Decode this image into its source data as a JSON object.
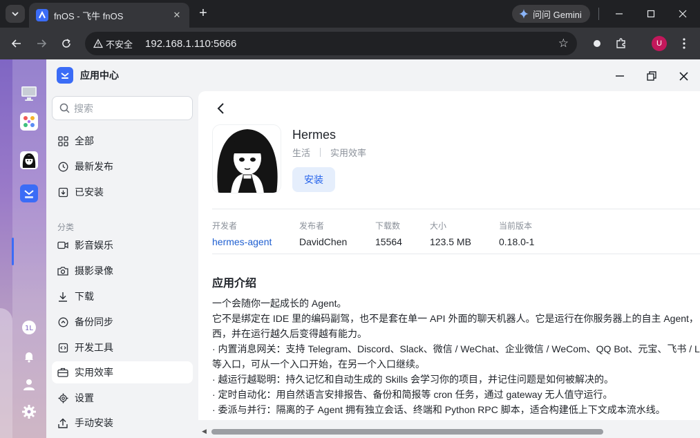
{
  "browser": {
    "tab_title": "fnOS - 飞牛 fnOS",
    "tab_close": "✕",
    "new_tab": "+",
    "gemini_label": "问问 Gemini",
    "insecure_label": "不安全",
    "url": "192.168.1.110:5666",
    "profile_initial": "U"
  },
  "window": {
    "title": "应用中心"
  },
  "sidebar": {
    "search_placeholder": "搜索",
    "items": [
      {
        "label": "全部",
        "icon": "grid-icon"
      },
      {
        "label": "最新发布",
        "icon": "clock-icon"
      },
      {
        "label": "已安装",
        "icon": "install-box-icon"
      }
    ],
    "section_label": "分类",
    "categories": [
      {
        "label": "影音娱乐",
        "icon": "video-icon"
      },
      {
        "label": "摄影录像",
        "icon": "camera-icon"
      },
      {
        "label": "下载",
        "icon": "download-icon"
      },
      {
        "label": "备份同步",
        "icon": "backup-icon"
      },
      {
        "label": "开发工具",
        "icon": "code-icon"
      },
      {
        "label": "实用效率",
        "icon": "toolbox-icon",
        "active": true
      }
    ],
    "bottom": [
      {
        "label": "设置",
        "icon": "gear-icon"
      },
      {
        "label": "手动安装",
        "icon": "upload-icon"
      }
    ]
  },
  "app": {
    "name": "Hermes",
    "tag1": "生活",
    "tag2": "实用效率",
    "install_label": "安装",
    "meta": [
      {
        "label": "开发者",
        "value": "hermes-agent"
      },
      {
        "label": "发布者",
        "value": "DavidChen"
      },
      {
        "label": "下载数",
        "value": "15564"
      },
      {
        "label": "大小",
        "value": "123.5 MB"
      },
      {
        "label": "当前版本",
        "value": "0.18.0-1"
      }
    ],
    "intro_title": "应用介绍",
    "intro_lines": [
      "一个会随你一起成长的 Agent。",
      "它不是绑定在 IDE 里的编码副驾，也不是套在单一 API 外面的聊天机器人。它是运行在你服务器上的自主 Agent，",
      "西，并在运行越久后变得越有能力。",
      "· 内置消息网关：支持 Telegram、Discord、Slack、微信 / WeChat、企业微信 / WeCom、QQ Bot、元宝、飞书 / L",
      "等入口，可从一个入口开始，在另一个入口继续。",
      "· 越运行越聪明：持久记忆和自动生成的 Skills 会学习你的项目，并记住问题是如何被解决的。",
      "· 定时自动化：用自然语言安排报告、备份和简报等 cron 任务，通过 gateway 无人值守运行。",
      "· 委派与并行：隔离的子 Agent 拥有独立会话、终端和 Python RPC 脚本，适合构建低上下文成本流水线。"
    ]
  }
}
